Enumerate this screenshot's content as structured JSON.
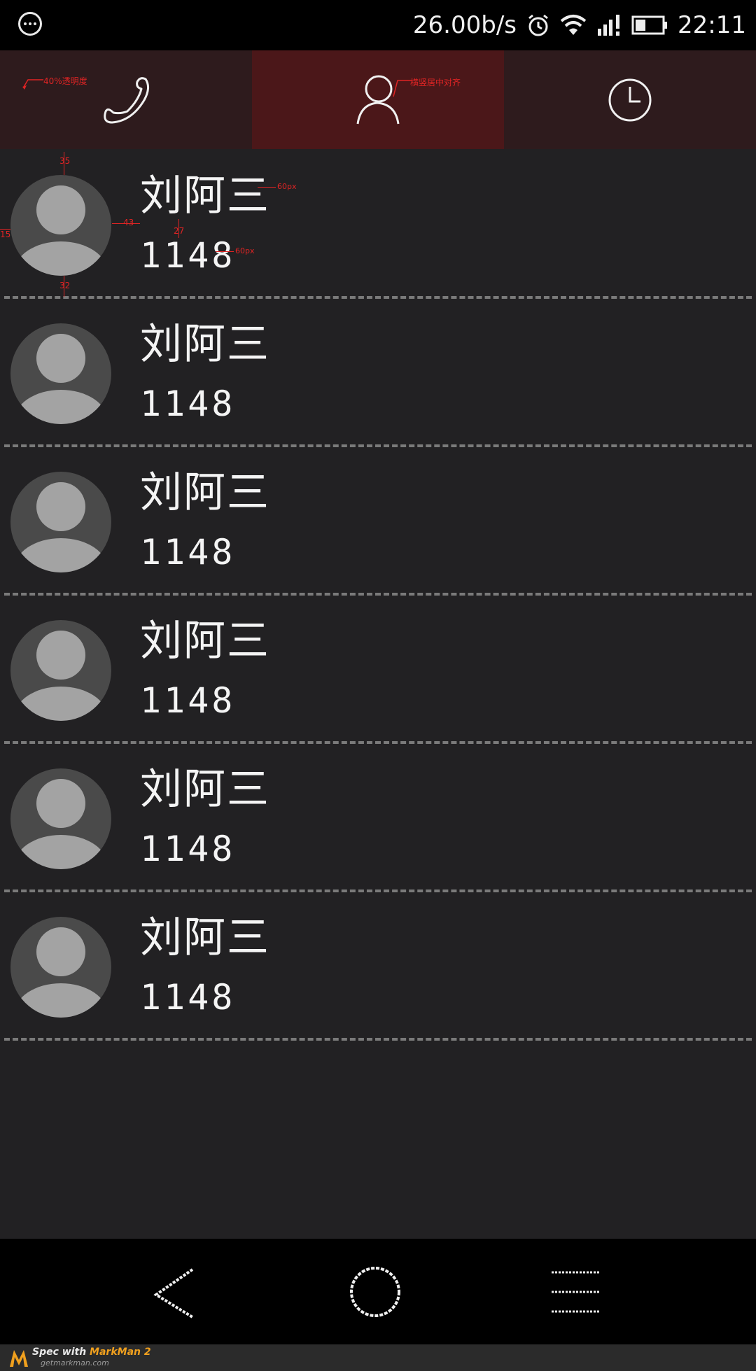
{
  "status_bar": {
    "speed": "26.00b/s",
    "time": "22:11",
    "icons": [
      "menu-dots-icon",
      "alarm-icon",
      "wifi-icon",
      "signal-icon",
      "battery-icon"
    ]
  },
  "tabs": [
    {
      "name": "phone",
      "icon": "phone-icon",
      "active": false
    },
    {
      "name": "contacts",
      "icon": "person-icon",
      "active": true
    },
    {
      "name": "recent",
      "icon": "clock-icon",
      "active": false
    }
  ],
  "annotations": {
    "tab1_note": "40%透明度",
    "tab2_note": "横竖居中对齐",
    "name_size": "60px",
    "number_size": "60px",
    "top_gap": "35",
    "bottom_gap": "32",
    "left_gap": "15",
    "avatar_text_gap": "43",
    "line_gap": "27"
  },
  "contacts": [
    {
      "name": "刘阿三",
      "number": "1148"
    },
    {
      "name": "刘阿三",
      "number": "1148"
    },
    {
      "name": "刘阿三",
      "number": "1148"
    },
    {
      "name": "刘阿三",
      "number": "1148"
    },
    {
      "name": "刘阿三",
      "number": "1148"
    },
    {
      "name": "刘阿三",
      "number": "1148"
    }
  ],
  "nav_bar": {
    "icons": [
      "back-icon",
      "home-icon",
      "menu-icon"
    ]
  },
  "footer": {
    "brand_prefix": "Spec with ",
    "brand": "MarkMan 2",
    "url": "getmarkman.com"
  },
  "colors": {
    "active_tab": "#4b1719",
    "inactive_tab": "#2e1b1d",
    "background": "#222123",
    "annotation": "#e02424"
  }
}
